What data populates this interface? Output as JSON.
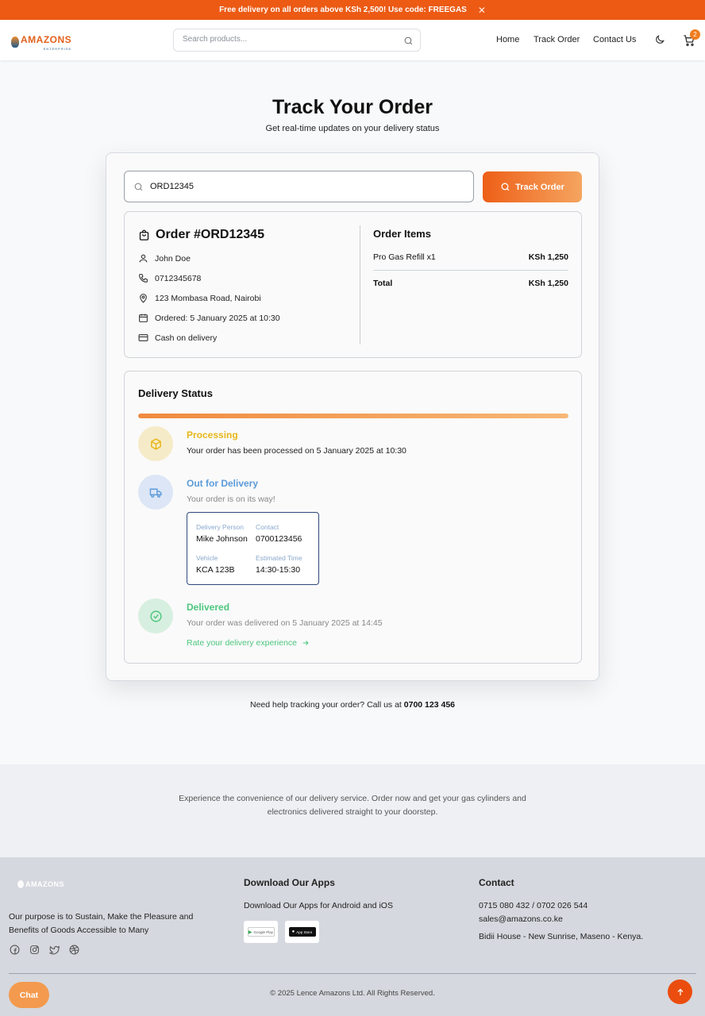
{
  "promo": {
    "text": "Free delivery on all orders above KSh 2,500! Use code: FREEGAS",
    "close": "✕"
  },
  "header": {
    "logo_text": "AMAZONS",
    "logo_sub": "ENTERPRISE",
    "search_placeholder": "Search products...",
    "nav": [
      "Home",
      "Track Order",
      "Contact Us"
    ],
    "cart_count": "2"
  },
  "page": {
    "title": "Track Your Order",
    "subtitle": "Get real-time updates on your delivery status"
  },
  "tracker": {
    "order_input_value": "ORD12345",
    "button_label": "Track Order"
  },
  "order": {
    "heading": "Order #ORD12345",
    "customer": "John Doe",
    "phone": "0712345678",
    "address": "123 Mombasa Road, Nairobi",
    "ordered": "Ordered: 5 January 2025 at 10:30",
    "payment": "Cash on delivery",
    "items_heading": "Order Items",
    "items": [
      {
        "name": "Pro Gas Refill x1",
        "price": "KSh 1,250"
      }
    ],
    "total_label": "Total",
    "total_value": "KSh 1,250"
  },
  "delivery": {
    "heading": "Delivery Status",
    "progress_percent": 100,
    "steps": [
      {
        "title": "Processing",
        "desc": "Your order has been processed on 5 January 2025 at 10:30"
      },
      {
        "title": "Out for Delivery",
        "desc": "Your order is on its way!"
      },
      {
        "title": "Delivered",
        "desc": "Your order was delivered on 5 January 2025 at 14:45"
      }
    ],
    "courier": {
      "person_label": "Delivery Person",
      "person": "Mike Johnson",
      "contact_label": "Contact",
      "contact": "0700123456",
      "vehicle_label": "Vehicle",
      "vehicle": "KCA 123B",
      "eta_label": "Estimated Time",
      "eta": "14:30-15:30"
    },
    "rate_link": "Rate your delivery experience"
  },
  "help": {
    "text": "Need help tracking your order? Call us at ",
    "phone": "0700 123 456"
  },
  "cta": {
    "text": "Experience the convenience of our delivery service. Order now and get your gas cylinders and electronics delivered straight to your doorstep."
  },
  "footer": {
    "logo_text": "AMAZONS",
    "purpose": "Our purpose is to Sustain, Make the Pleasure and Benefits of Goods Accessible to Many",
    "apps_heading": "Download Our Apps",
    "apps_text": "Download Our Apps for Android and iOS",
    "google_play": "Google Play",
    "app_store": "App Store",
    "contact_heading": "Contact",
    "phones": "0715 080 432 / 0702 026 544",
    "email": "sales@amazons.co.ke",
    "address": "Bidii House - New Sunrise, Maseno - Kenya.",
    "copyright": "© 2025 Lence Amazons Ltd. All Rights Reserved."
  },
  "chat": {
    "label": "Chat"
  },
  "colors": {
    "brand": "#ec5a14",
    "processing": "#e6b619",
    "out_for_delivery": "#5b9bd9",
    "delivered": "#4cc67e"
  }
}
